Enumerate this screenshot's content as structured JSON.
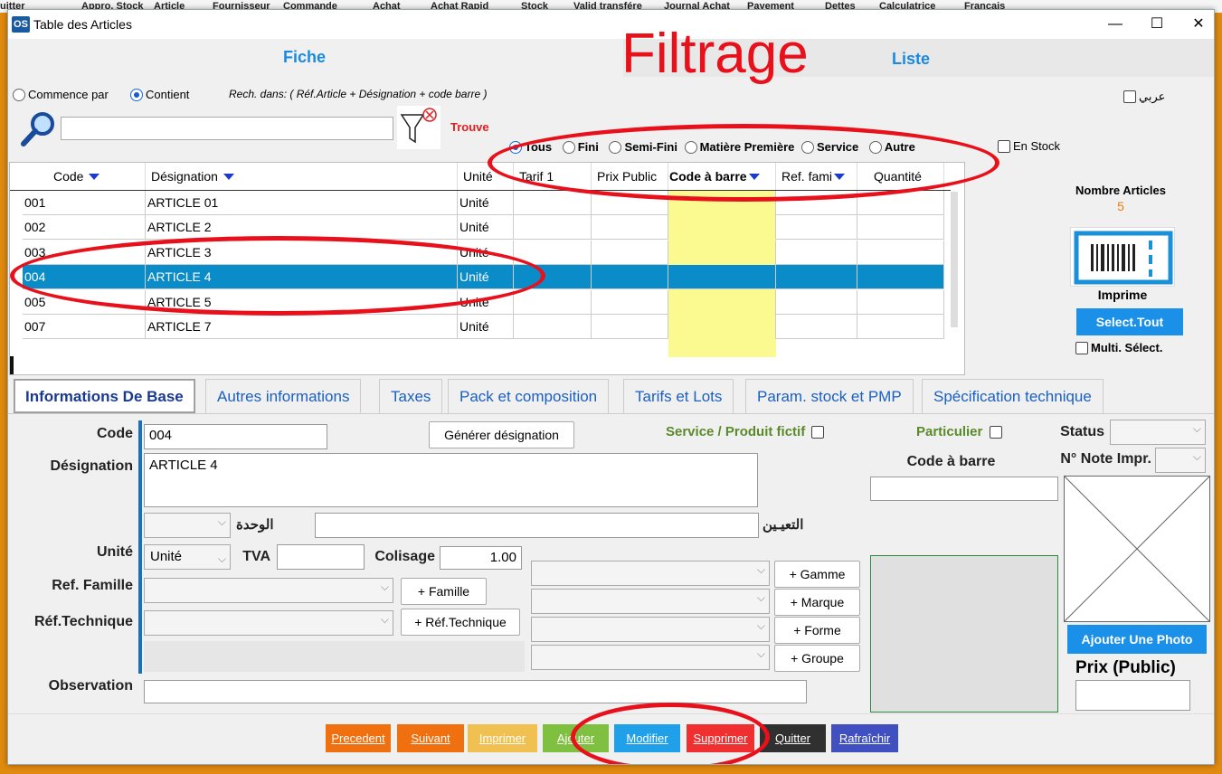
{
  "bg_menu": [
    "uitter",
    "Appro. Stock",
    "Article",
    "Fournisseur",
    "Commande",
    "Achat",
    "Achat Rapid",
    "Stock",
    "Valid transfére",
    "Journal Achat",
    "Payement",
    "Dettes",
    "Calculatrice",
    "Français"
  ],
  "window": {
    "icon": "OS",
    "title": "Table des Articles",
    "minimize": "—",
    "maximize": "☐",
    "close": "✕"
  },
  "annotation": {
    "filtrage": "Filtrage"
  },
  "header_tabs": {
    "fiche": "Fiche",
    "liste": "Liste"
  },
  "search": {
    "commence_par": "Commence par",
    "contient": "Contient",
    "selected": "contient",
    "hint": "Rech. dans: ( Réf.Article + Désignation + code barre )",
    "value": "",
    "trouve": "Trouve",
    "arabic_label": "عربي"
  },
  "filters": {
    "options": [
      "Tous",
      "Fini",
      "Semi-Fini",
      "Matière Première",
      "Service",
      "Autre"
    ],
    "selected": 0,
    "en_stock": "En Stock"
  },
  "grid": {
    "columns": [
      "Code",
      "Désignation",
      "Unité",
      "Tarif 1",
      "Prix Public",
      "Code à barre",
      "Ref. fami",
      "Quantité"
    ],
    "rows": [
      {
        "code": "001",
        "designation": "ARTICLE 01",
        "unite": "Unité"
      },
      {
        "code": "002",
        "designation": "ARTICLE 2",
        "unite": "Unité"
      },
      {
        "code": "003",
        "designation": "ARTICLE 3",
        "unite": "Unité"
      },
      {
        "code": "004",
        "designation": "ARTICLE 4",
        "unite": "Unité"
      },
      {
        "code": "005",
        "designation": "ARTICLE 5",
        "unite": "Unité"
      },
      {
        "code": "007",
        "designation": "ARTICLE 7",
        "unite": "Unité"
      }
    ],
    "selected_index": 3
  },
  "side": {
    "nombre_articles_label": "Nombre Articles",
    "nombre_articles": "5",
    "imprime": "Imprime",
    "select_tout": "Select.Tout",
    "multi_select": "Multi. Sélect."
  },
  "tabs": [
    "Informations De Base",
    "Autres informations",
    "Taxes",
    "Pack et composition",
    "Tarifs et Lots",
    "Param. stock et PMP",
    "Spécification technique"
  ],
  "form": {
    "code_label": "Code",
    "code": "004",
    "generer": "Générer désignation",
    "service_fictif": "Service / Produit fictif",
    "particulier": "Particulier",
    "status": "Status",
    "designation_label": "Désignation",
    "designation": "ARTICLE 4",
    "code_barre": "Code à barre",
    "note_impr": "N° Note Impr.",
    "wahda": "الوحدة",
    "taayin": "التعيـين",
    "unite_label": "Unité",
    "unite": "Unité",
    "tva": "TVA",
    "colisage_label": "Colisage",
    "colisage": "1.00",
    "ref_famille": "Ref. Famille",
    "add_famille": "+ Famille",
    "ref_technique": "Réf.Technique",
    "add_technique": "+ Réf.Technique",
    "gamme": "+ Gamme",
    "marque": "+ Marque",
    "forme": "+ Forme",
    "groupe": "+ Groupe",
    "observation": "Observation",
    "ajouter_photo": "Ajouter Une Photo",
    "prix_public": "Prix (Public)"
  },
  "buttons": [
    {
      "label": "Precedent",
      "color": "#f07010"
    },
    {
      "label": "Suivant",
      "color": "#f07010"
    },
    {
      "label": "Imprimer",
      "color": "#f0c050"
    },
    {
      "label": "Ajouter",
      "color": "#80c040"
    },
    {
      "label": "Modifier",
      "color": "#20a0e8"
    },
    {
      "label": "Supprimer",
      "color": "#f03030"
    },
    {
      "label": "Quitter",
      "color": "#303030"
    },
    {
      "label": "Rafraîchir",
      "color": "#4050c0"
    }
  ]
}
